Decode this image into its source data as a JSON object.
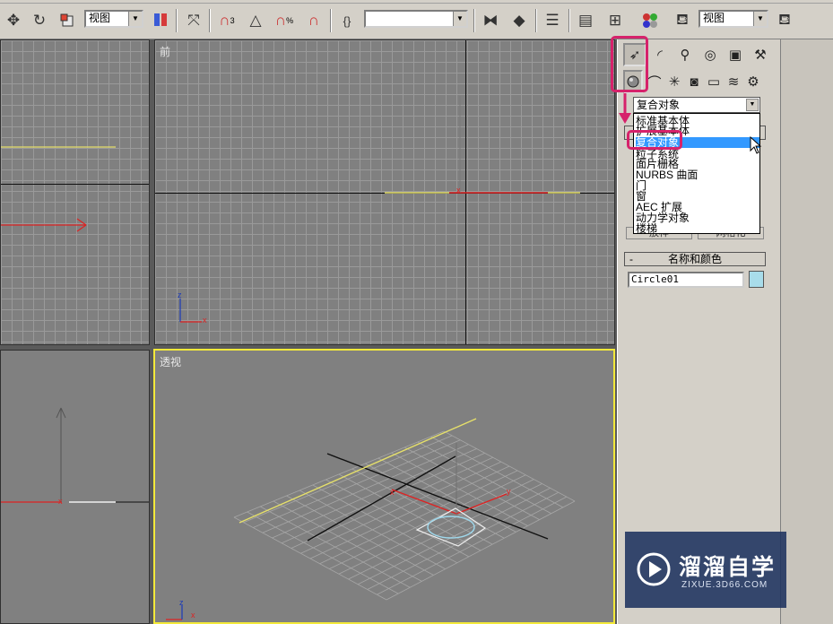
{
  "toolbar": {
    "view_select_1": "视图",
    "view_select_2": "视图",
    "named_selection": "",
    "snap_label": "3",
    "percent_label": "%"
  },
  "viewports": {
    "front_label": "前",
    "perspective_label": "透视",
    "axis_x": "x",
    "axis_y": "y",
    "axis_z": "z"
  },
  "command_panel": {
    "category_combo_value": "复合对象",
    "dropdown_items": [
      "标准基本体",
      "扩展基本体",
      "复合对象",
      "粒子系统",
      "面片栅格",
      "NURBS 曲面",
      "门",
      "窗",
      "AEC 扩展",
      "动力学对象",
      "楼梯"
    ],
    "selected_index": 2,
    "object_buttons": [
      "放样",
      "网格化"
    ],
    "name_color_header": "名称和颜色",
    "rollout_minus": "-",
    "object_name": "Circle01",
    "object_color": "#a8dcea"
  },
  "watermark": {
    "title": "溜溜自学",
    "subtitle": "ZIXUE.3D66.COM"
  },
  "highlight_color": "#d6226b"
}
